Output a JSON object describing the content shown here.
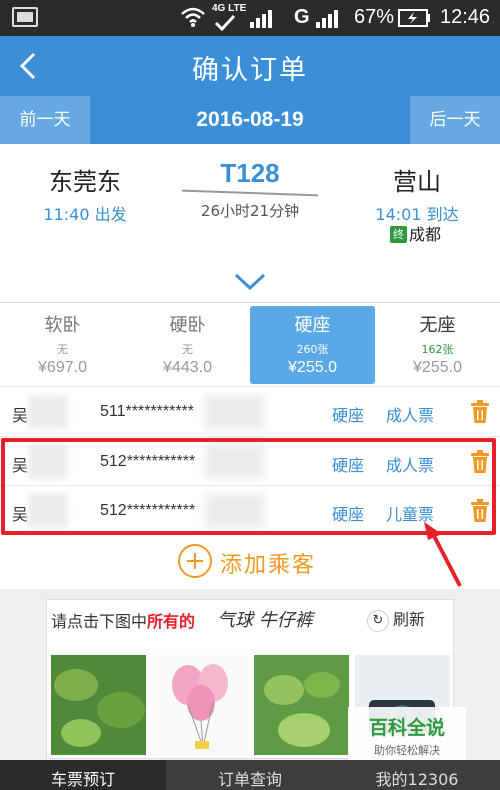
{
  "status_bar": {
    "network": "4G LTE",
    "carrier_g": "G",
    "battery": "67%",
    "time": "12:46"
  },
  "header": {
    "title": "确认订单",
    "back_icon": "chevron-left-icon"
  },
  "date_bar": {
    "prev_label": "前一天",
    "date": "2016-08-19",
    "next_label": "后一天"
  },
  "train": {
    "from_station": "东莞东",
    "depart_time": "11:40 出发",
    "train_no": "T128",
    "duration": "26小时21分钟",
    "to_station": "营山",
    "arrive_time": "14:01 到达",
    "terminal_badge": "终",
    "terminal_station": "成都"
  },
  "seats": [
    {
      "name": "软卧",
      "count": "无",
      "price": "¥697.0"
    },
    {
      "name": "硬卧",
      "count": "无",
      "price": "¥443.0"
    },
    {
      "name": "硬座",
      "count": "260张",
      "price": "¥255.0"
    },
    {
      "name": "无座",
      "count": "162张",
      "price": "¥255.0"
    }
  ],
  "passengers": [
    {
      "name": "吴",
      "id": "511***********",
      "seat": "硬座",
      "ticket": "成人票"
    },
    {
      "name": "吴",
      "id": "512***********",
      "seat": "硬座",
      "ticket": "成人票"
    },
    {
      "name": "吴",
      "id": "512***********",
      "seat": "硬座",
      "ticket": "儿童票"
    }
  ],
  "add_passenger_label": "添加乘客",
  "ad": {
    "prompt_prefix": "请点击下图中",
    "prompt_highlight": "所有的",
    "handwritten": "气球  牛仔裤",
    "refresh_label": "刷新"
  },
  "watermark": {
    "title": "百科全说",
    "subtitle": "助你轻松解决"
  },
  "bottom_nav": [
    {
      "label": "车票预订"
    },
    {
      "label": "订单查询"
    },
    {
      "label": "我的12306"
    }
  ],
  "colors": {
    "primary": "#3a8fd6",
    "accent_orange": "#f09a24",
    "highlight_red": "#e8202a",
    "green": "#2e9a3e"
  }
}
